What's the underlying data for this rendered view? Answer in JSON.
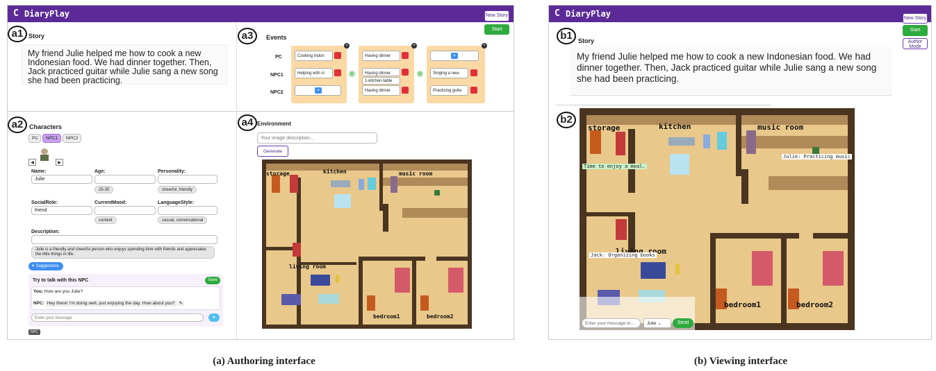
{
  "app_name": "DiaryPlay",
  "authoring": {
    "new_story_label": "New Story",
    "start_label": "Start",
    "tags": {
      "a1": "a1",
      "a2": "a2",
      "a3": "a3",
      "a4": "a4"
    },
    "story_heading": "Story",
    "story_text": "My friend Julie helped me how to cook a new Indonesian food. We had dinner together. Then, Jack practiced guitar while Julie sang a new song she had been practicing.",
    "characters": {
      "heading": "Characters",
      "tabs": [
        "PC",
        "NPC1",
        "NPC2"
      ],
      "prev": "◀",
      "next": "▶",
      "fields": {
        "name_label": "Name:",
        "name_value": "Julie",
        "age_label": "Age:",
        "age_chip": "25-35",
        "personality_label": "Personality:",
        "personality_chip": "cheerful, friendly",
        "socialrole_label": "SocialRole:",
        "socialrole_value": "friend",
        "mood_label": "CurrentMood:",
        "mood_chip": "content",
        "language_label": "LanguageStyle:",
        "language_chip": "casual, conversational",
        "description_label": "Description:",
        "description_chip": "Julie is a friendly and cheerful person who enjoys spending time with friends and appreciates the little things in life."
      },
      "suggestions_label": "Suggestions",
      "talk": {
        "heading": "Try to talk with this NPC",
        "save_label": "Save",
        "you_prefix": "You:",
        "you_text": "How are you Julie?",
        "npc_prefix": "NPC:",
        "npc_text": "Hey there! I'm doing well, just enjoying the day. How about you?",
        "input_placeholder": "Enter your message",
        "send_icon": "➤",
        "badge": "NPC"
      }
    },
    "events": {
      "heading": "Events",
      "rows": [
        "PC",
        "NPC1",
        "NPC2"
      ],
      "col1": [
        "Cooking Indon",
        "Helping with cr"
      ],
      "col2": [
        "Having dinner",
        "Having dinner",
        "1-kitchen-table",
        "Having dinner"
      ],
      "col3": [
        "Singing a new",
        "Practicing guita"
      ],
      "plus": "+",
      "arrow": "»"
    },
    "environment": {
      "heading": "Environment",
      "placeholder": "Your image description...",
      "generate_label": "Generate",
      "rooms": [
        "storage",
        "kitchen",
        "music room",
        "living room",
        "bedroom1",
        "bedroom2"
      ]
    },
    "caption": "(a) Authoring interface"
  },
  "viewing": {
    "new_story_label": "New Story",
    "start_label": "Start",
    "author_mode_label": "Author Mode",
    "tags": {
      "b1": "b1",
      "b2": "b2"
    },
    "story_heading": "Story",
    "story_text": "My friend Julie helped me how to cook a new Indonesian food. We had dinner together. Then, Jack practiced guitar while Julie sang a new song she had been practicing.",
    "rooms": [
      "storage",
      "kitchen",
      "music room",
      "living room",
      "bedroom1",
      "bedroom2"
    ],
    "speech": {
      "meal": "Time to enjoy a meal.",
      "julie": "Julie: Practicing music",
      "jack": "Jack: Organizing books"
    },
    "input_placeholder": "Enter your message to...",
    "select_value": "Julie",
    "send_label": "Send",
    "caption": "(b) Viewing interface"
  },
  "colors": {
    "header": "#5b2a97",
    "green": "#2eaa3e",
    "floor": "#e9c88b",
    "wall": "#4a3520",
    "event_bg": "#fbd9a4"
  }
}
